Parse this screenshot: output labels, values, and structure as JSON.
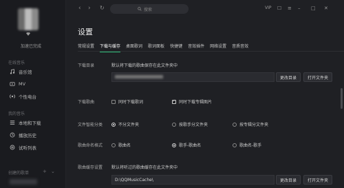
{
  "sidebar": {
    "user_name": "加速已完成",
    "section_online": "在线音乐",
    "online_items": [
      {
        "icon": "music-hall-icon",
        "label": "音乐馆"
      },
      {
        "icon": "mv-icon",
        "label": "MV"
      },
      {
        "icon": "radio-icon",
        "label": "个性电台"
      }
    ],
    "section_mine": "我的音乐",
    "mine_items": [
      {
        "icon": "local-download-icon",
        "label": "本地和下载"
      },
      {
        "icon": "history-icon",
        "label": "播放历史"
      },
      {
        "icon": "list-icon",
        "label": "试听列表"
      }
    ],
    "section_playlists": "创建的歌单"
  },
  "topbar": {
    "back": "‹",
    "forward": "›",
    "refresh": "↻",
    "search_placeholder": "搜索",
    "vip": "VIP",
    "icons": [
      "skin-icon",
      "menu-icon",
      "minimize-icon",
      "maximize-icon",
      "close-icon"
    ]
  },
  "settings": {
    "title": "设置",
    "tabs": [
      "常规设置",
      "下载与缓存",
      "桌面歌词",
      "歌词面板",
      "快捷键",
      "音效插件",
      "网络设置",
      "音质音效"
    ],
    "active_tab": 1,
    "download_dir": {
      "label": "下载目录",
      "hint": "默认将下载的歌曲保存在此文件夹中",
      "change_button": "更改目录",
      "open_button": "打开文件夹"
    },
    "download_songs": {
      "label": "下载歌曲",
      "opt_lyrics": "同时下载歌词",
      "opt_cover": "同时下载专辑图片",
      "lyrics_checked": false,
      "cover_checked": true
    },
    "smart_folder": {
      "label": "文件智能分类",
      "options": [
        "不分文件夹",
        "按歌手分文件夹",
        "按专辑分文件夹"
      ],
      "selected": 0
    },
    "naming": {
      "label": "歌曲命名格式",
      "options": [
        "歌曲名",
        "歌手-歌曲名",
        "歌曲名-歌手"
      ],
      "selected": 1
    },
    "cache_dir": {
      "label": "歌曲缓存设置",
      "hint": "默认将听过的歌曲缓存在此文件夹中",
      "path": "D:\\QQMusicCache\\",
      "change_button": "更改目录",
      "open_button": "打开文件夹"
    }
  }
}
